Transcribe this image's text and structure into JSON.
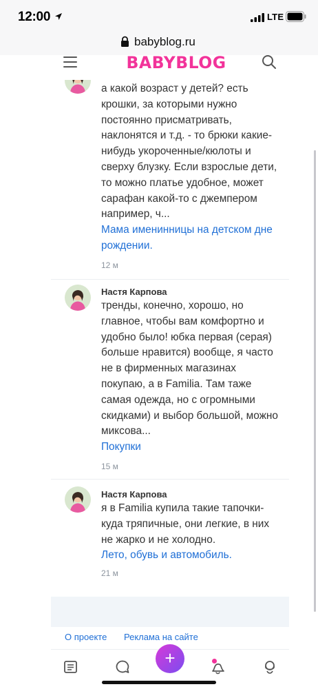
{
  "status_bar": {
    "time": "12:00",
    "network": "LTE"
  },
  "url_bar": {
    "url": "babyblog.ru"
  },
  "header": {
    "logo_text": "BABYBLOG",
    "brand_color": "#f2339a"
  },
  "comments": [
    {
      "text": "а какой возраст у детей? есть крошки, за которыми нужно постоянно присматривать, наклонятся и т.д. - то брюки какие-нибудь укороченные/кюлоты и сверху блузку. Если взрослые дети, то можно платье удобное, может сарафан какой-то с джемпером например, ч...",
      "link": "Мама именинницы на детском дне рождении.",
      "time": "12 м"
    },
    {
      "author": "Настя Карпова",
      "text": "тренды, конечно, хорошо, но главное, чтобы вам комфортно и удобно было! юбка первая (серая) больше нравится) вообще, я часто не в фирменных магазинах покупаю, а в Familia. Там таже самая одежда, но с огромными скидками) и выбор большой, можно миксова...",
      "link": "Покупки",
      "time": "15 м"
    },
    {
      "author": "Настя Карпова",
      "text": "я в Familia купила такие тапочки-куда тряпичные, они легкие, в них не жарко и не холодно.",
      "link": "Лето, обувь и автомобиль.",
      "time": "21 м"
    }
  ],
  "footer": {
    "about": "О проекте",
    "ads": "Реклама на сайте"
  },
  "bottom_nav": {
    "items": [
      "feed-icon",
      "chat-icon",
      "add-icon",
      "notifications-icon",
      "community-icon"
    ],
    "add_label": "+"
  }
}
